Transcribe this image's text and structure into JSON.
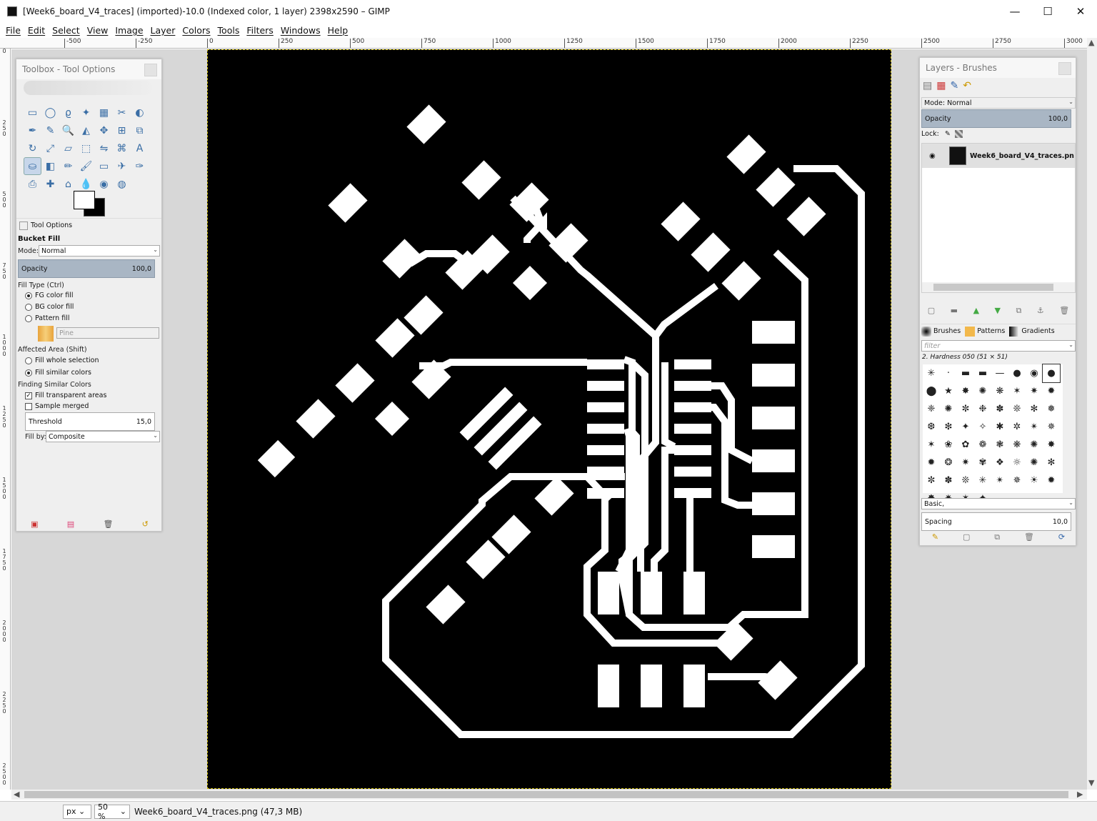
{
  "window": {
    "title": "[Week6_board_V4_traces] (imported)-10.0 (Indexed color, 1 layer) 2398x2590 – GIMP",
    "minimize": "—",
    "maximize": "☐",
    "close": "✕"
  },
  "menu": [
    "File",
    "Edit",
    "Select",
    "View",
    "Image",
    "Layer",
    "Colors",
    "Tools",
    "Filters",
    "Windows",
    "Help"
  ],
  "ruler_h_labels": [
    "-500",
    "-250",
    "0",
    "250",
    "500",
    "750",
    "1000",
    "1250",
    "1500",
    "1750",
    "2000",
    "2250",
    "2500",
    "2750",
    "3000"
  ],
  "ruler_v_labels": [
    "0",
    "250",
    "500",
    "750",
    "1000",
    "1250",
    "1500",
    "1750",
    "2000",
    "2250",
    "2500"
  ],
  "toolbox": {
    "title": "Toolbox - Tool Options",
    "tool_icons": [
      "rect-select",
      "ellipse-select",
      "free-select",
      "fuzzy-select",
      "select-by-color",
      "scissors",
      "foreground-select",
      "paths",
      "color-picker",
      "zoom",
      "measure",
      "move",
      "align",
      "crop",
      "rotate",
      "scale",
      "shear",
      "perspective",
      "flip",
      "cage",
      "text",
      "bucket-fill",
      "blend",
      "pencil",
      "paintbrush",
      "eraser",
      "airbrush",
      "ink",
      "clone",
      "heal",
      "perspective-clone",
      "blur",
      "smudge",
      "dodge-burn"
    ],
    "tool_glyphs": [
      "▭",
      "◯",
      "ϱ",
      "✦",
      "▦",
      "✂",
      "◐",
      "✒",
      "✎",
      "🔍",
      "◭",
      "✥",
      "⊞",
      "⧉",
      "↻",
      "⤢",
      "▱",
      "⬚",
      "⇋",
      "⌘",
      "A",
      "⛀",
      "◧",
      "✏",
      "🖌",
      "▭",
      "✈",
      "✑",
      "⎙",
      "✚",
      "⌂",
      "💧",
      "◉",
      "◍"
    ],
    "options_tab": "Tool Options",
    "tool_name": "Bucket Fill",
    "mode_label": "Mode:",
    "mode_value": "Normal",
    "opacity_label": "Opacity",
    "opacity_value": "100,0",
    "fill_type_label": "Fill Type  (Ctrl)",
    "fill_options": [
      "FG color fill",
      "BG color fill",
      "Pattern fill"
    ],
    "pattern_name": "Pine",
    "affected_area_label": "Affected Area  (Shift)",
    "area_options": [
      "Fill whole selection",
      "Fill similar colors"
    ],
    "finding_label": "Finding Similar Colors",
    "fill_transparent": "Fill transparent areas",
    "sample_merged": "Sample merged",
    "threshold_label": "Threshold",
    "threshold_value": "15,0",
    "fill_by_label": "Fill by:",
    "fill_by_value": "Composite"
  },
  "layers": {
    "title": "Layers - Brushes",
    "mode_label": "Mode: Normal",
    "opacity_label": "Opacity",
    "opacity_value": "100,0",
    "lock_label": "Lock:",
    "layer_name": "Week6_board_V4_traces.pn",
    "tabs": [
      "Brushes",
      "Patterns",
      "Gradients"
    ],
    "filter_placeholder": "filter",
    "brush_name": "2. Hardness 050 (51 × 51)",
    "brush_tag": "Basic,",
    "spacing_label": "Spacing",
    "spacing_value": "10,0"
  },
  "status": {
    "unit": "px",
    "zoom": "50 %",
    "file_info": "Week6_board_V4_traces.png (47,3 MB)"
  }
}
